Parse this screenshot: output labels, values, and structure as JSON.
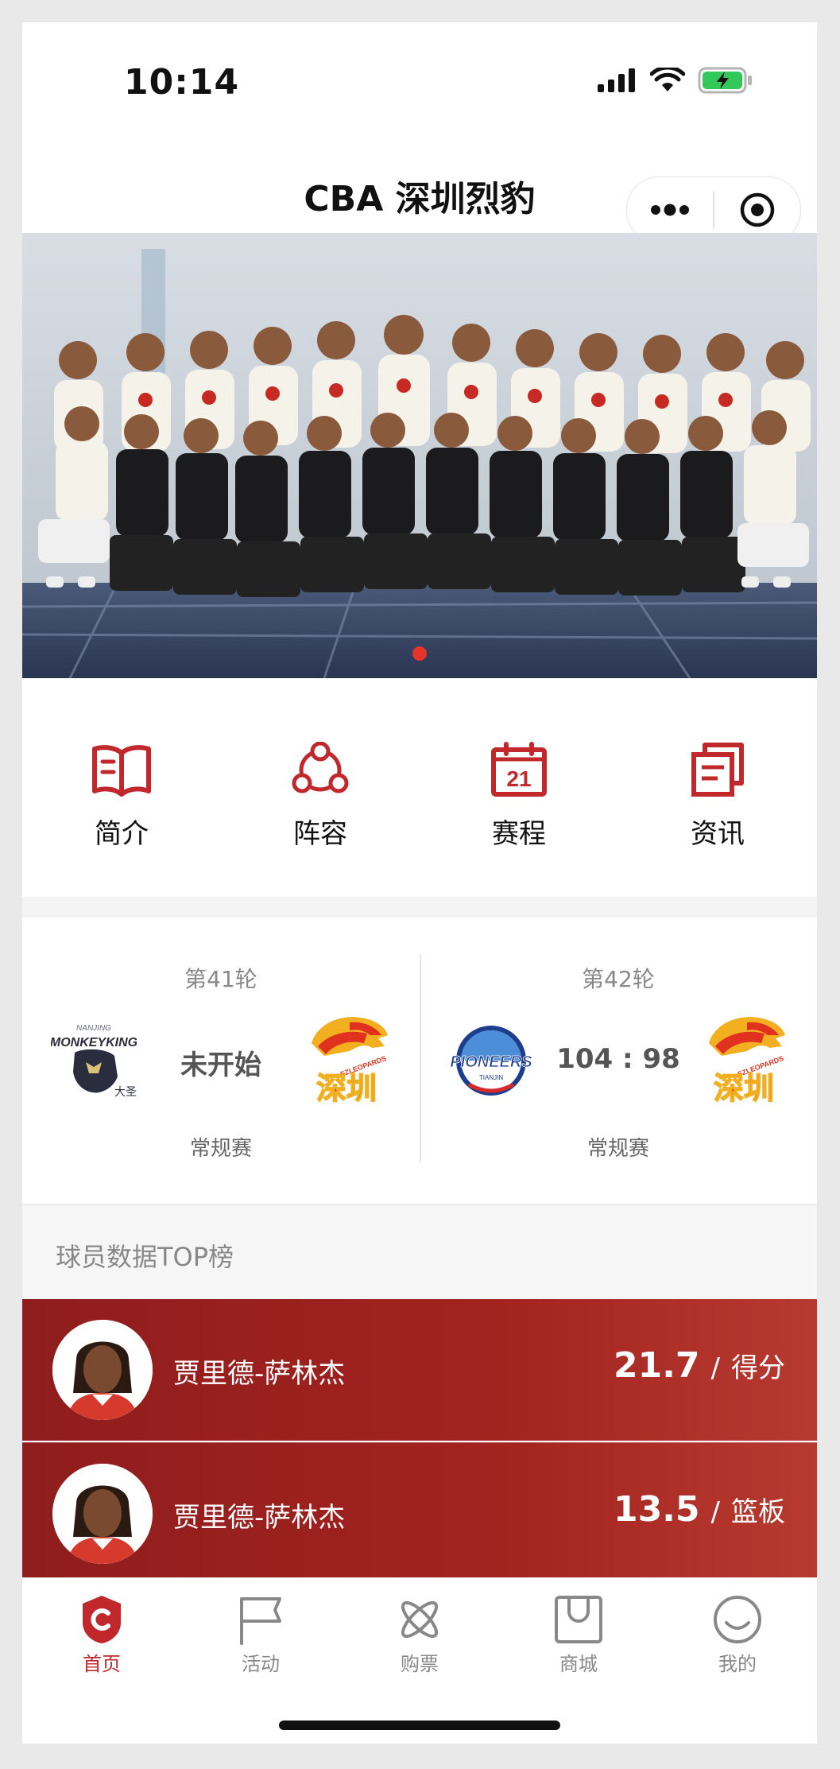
{
  "status_bar": {
    "time": "10:14"
  },
  "nav": {
    "title": "CBA 深圳烈豹"
  },
  "banner": {
    "slide_count": 1,
    "active_index": 0
  },
  "menu": [
    {
      "label": "简介",
      "icon": "book-icon"
    },
    {
      "label": "阵容",
      "icon": "team-icon"
    },
    {
      "label": "赛程",
      "icon": "calendar-icon",
      "date": "21"
    },
    {
      "label": "资讯",
      "icon": "news-icon"
    }
  ],
  "matches": [
    {
      "round": "第41轮",
      "score": "未开始",
      "stage": "常规赛"
    },
    {
      "round": "第42轮",
      "score": "104 : 98",
      "stage": "常规赛"
    }
  ],
  "toplist": {
    "title": "球员数据TOP榜",
    "players": [
      {
        "name": "贾里德-萨林杰",
        "value": "21.7",
        "sep": "/",
        "label": "得分"
      },
      {
        "name": "贾里德-萨林杰",
        "value": "13.5",
        "sep": "/",
        "label": "篮板"
      }
    ]
  },
  "tabbar": [
    {
      "label": "首页",
      "icon": "home-shield-icon",
      "active": true
    },
    {
      "label": "活动",
      "icon": "flag-icon",
      "active": false
    },
    {
      "label": "购票",
      "icon": "ticket-icon",
      "active": false
    },
    {
      "label": "商城",
      "icon": "shop-bag-icon",
      "active": false
    },
    {
      "label": "我的",
      "icon": "smile-icon",
      "active": false
    }
  ],
  "colors": {
    "accent": "#c0282c",
    "row_bg": "#9e221f",
    "banner_dot": "#e8352b"
  }
}
